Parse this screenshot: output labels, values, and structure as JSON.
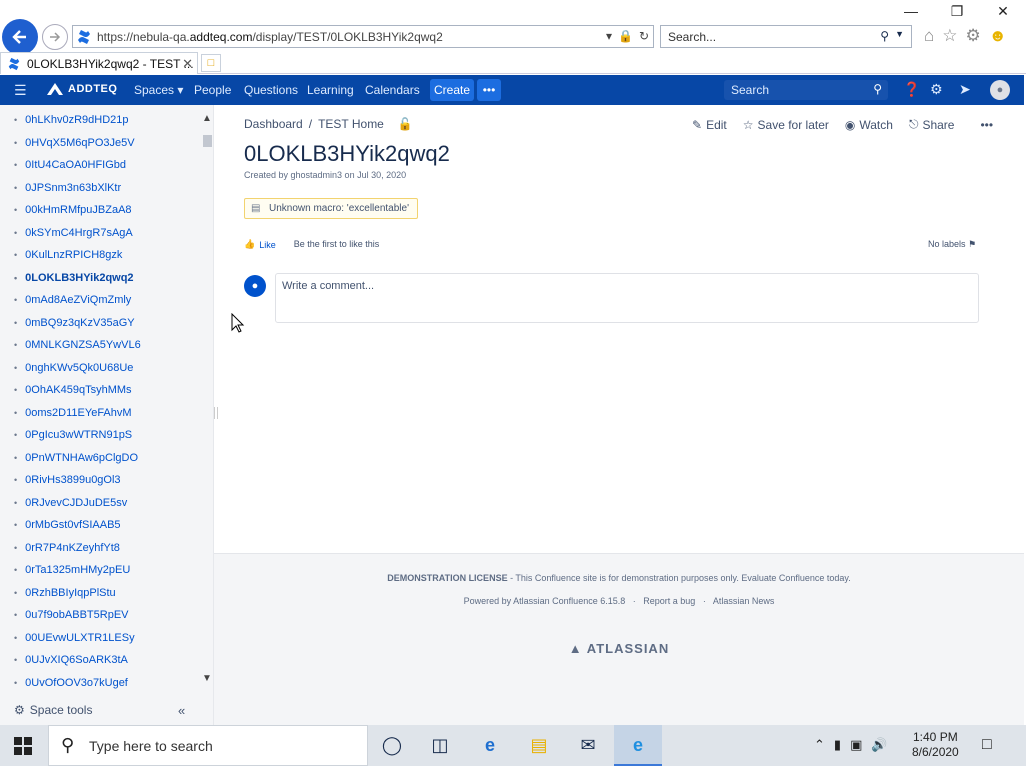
{
  "browser": {
    "url_prefix": "https://nebula-qa.",
    "url_domain": "addteq.com",
    "url_path": "/display/TEST/0LOKLB3HYik2qwq2",
    "search_placeholder": "Search...",
    "tab_title": "0LOKLB3HYik2qwq2 - TEST ..."
  },
  "nav": {
    "logo": "ADDTEQ",
    "spaces": "Spaces",
    "people": "People",
    "questions": "Questions",
    "learning": "Learning",
    "calendars": "Calendars",
    "create": "Create",
    "more": "•••",
    "search_placeholder": "Search"
  },
  "sidebar": {
    "items": [
      {
        "label": "0hLKhv0zR9dHD21p"
      },
      {
        "label": "0HVqX5M6qPO3Je5V"
      },
      {
        "label": "0ItU4CaOA0HFIGbd"
      },
      {
        "label": "0JPSnm3n63bXlKtr"
      },
      {
        "label": "00kHmRMfpuJBZaA8"
      },
      {
        "label": "0kSYmC4HrgR7sAgA"
      },
      {
        "label": "0KulLnzRPICH8gzk"
      },
      {
        "label": "0LOKLB3HYik2qwq2",
        "current": true
      },
      {
        "label": "0mAd8AeZViQmZmly"
      },
      {
        "label": "0mBQ9z3qKzV35aGY"
      },
      {
        "label": "0MNLKGNZSA5YwVL6"
      },
      {
        "label": "0nghKWv5Qk0U68Ue"
      },
      {
        "label": "0OhAK459qTsyhMMs"
      },
      {
        "label": "0oms2D11EYeFAhvM"
      },
      {
        "label": "0PgIcu3wWTRN91pS"
      },
      {
        "label": "0PnWTNHAw6pClgDO"
      },
      {
        "label": "0RivHs3899u0gOl3"
      },
      {
        "label": "0RJvevCJDJuDE5sv"
      },
      {
        "label": "0rMbGst0vfSIAAB5"
      },
      {
        "label": "0rR7P4nKZeyhfYt8"
      },
      {
        "label": "0rTa1325mHMy2pEU"
      },
      {
        "label": "0RzhBBIyIqpPlStu"
      },
      {
        "label": "0u7f9obABBT5RpEV"
      },
      {
        "label": "00UEvwULXTR1LESy"
      },
      {
        "label": "0UJvXIQ6SoARK3tA"
      },
      {
        "label": "0UvOfOOV3o7kUgef"
      }
    ],
    "space_tools": "Space tools"
  },
  "page": {
    "breadcrumb": [
      "Dashboard",
      "TEST Home"
    ],
    "actions": {
      "edit": "Edit",
      "save": "Save for later",
      "watch": "Watch",
      "share": "Share",
      "more": "•••"
    },
    "title": "0LOKLB3HYik2qwq2",
    "meta": "Created by ghostadmin3 on Jul 30, 2020",
    "macro_error": "Unknown macro: 'excellentable'",
    "like": "Like",
    "like_prompt": "Be the first to like this",
    "labels": "No labels",
    "comment_placeholder": "Write a comment..."
  },
  "footer": {
    "license_bold": "DEMONSTRATION LICENSE",
    "license_text": " - This Confluence site is for demonstration purposes only. Evaluate Confluence today.",
    "powered": "Powered by Atlassian Confluence 6.15.8",
    "bug": "Report a bug",
    "news": "Atlassian News",
    "dot": "·",
    "logo": "ATLASSIAN"
  },
  "taskbar": {
    "search_placeholder": "Type here to search",
    "time": "1:40 PM",
    "date": "8/6/2020"
  },
  "colors": {
    "nav_bg": "#0747a6",
    "link": "#0052cc",
    "create_btn": "#1c6de0"
  }
}
